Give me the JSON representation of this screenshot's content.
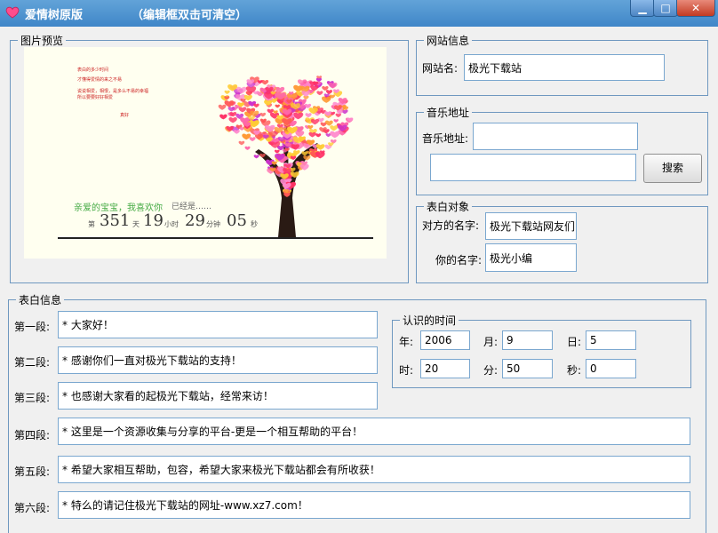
{
  "window": {
    "title": "爱情树原版",
    "subtitle": "（编辑框双击可清空）",
    "min_label": "▁",
    "max_label": "□",
    "close_label": "✕"
  },
  "preview": {
    "legend": "图片预览",
    "text_lines": [
      "表白的多少时间",
      "才懂得爱情的来之不易",
      "说说相爱，相恨，是多么不易的幸福",
      "所以要要好好相爱",
      "真好"
    ],
    "green_line": "亲爱的宝宝，我喜欢你",
    "grey_line": "已经是……",
    "counter": {
      "prefix": "第",
      "days": "351",
      "days_unit": "天",
      "hours": "19",
      "hours_unit": "小时",
      "minutes": "29",
      "minutes_unit": "分钟",
      "seconds": "05",
      "seconds_unit": "秒"
    }
  },
  "site_info": {
    "legend": "网站信息",
    "label": "网站名:",
    "value": "极光下载站"
  },
  "music": {
    "legend": "音乐地址",
    "label": "音乐地址:",
    "value": "",
    "search_value": "",
    "search_label": "搜索"
  },
  "target": {
    "legend": "表白对象",
    "other_label": "对方的名字:",
    "other_value": "极光下载站网友们",
    "your_label": "你的名字:",
    "your_value": "极光小编"
  },
  "confession": {
    "legend": "表白信息",
    "paragraphs": [
      {
        "label": "第一段:",
        "value": "* 大家好！"
      },
      {
        "label": "第二段:",
        "value": "* 感谢你们一直对极光下载站的支持！"
      },
      {
        "label": "第三段:",
        "value": "* 也感谢大家看的起极光下载站，经常来访！"
      },
      {
        "label": "第四段:",
        "value": "* 这里是一个资源收集与分享的平台-更是一个相互帮助的平台！"
      },
      {
        "label": "第五段:",
        "value": "* 希望大家相互帮助，包容，希望大家来极光下载站都会有所收获！"
      },
      {
        "label": "第六段:",
        "value": "* 特么的请记住极光下载站的网址-www.xz7.com！"
      }
    ]
  },
  "time": {
    "legend": "认识的时间",
    "year_label": "年:",
    "year_value": "2006",
    "month_label": "月:",
    "month_value": "9",
    "day_label": "日:",
    "day_value": "5",
    "hour_label": "时:",
    "hour_value": "20",
    "minute_label": "分:",
    "minute_value": "50",
    "second_label": "秒:",
    "second_value": "0"
  },
  "colors": {
    "titlebar": "#4a90d0",
    "border": "#6f98c0",
    "heart_colors": [
      "#ff3366",
      "#ff66aa",
      "#ff9933",
      "#ffcc33",
      "#cc33cc",
      "#ff5555",
      "#ff88cc"
    ]
  }
}
